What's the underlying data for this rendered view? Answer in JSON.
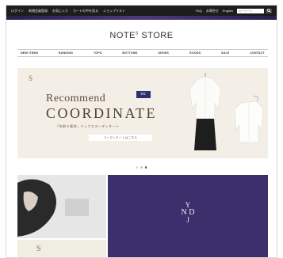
{
  "topbar": {
    "links_left": [
      "ログイン",
      "新規会員登録",
      "お気に入り",
      "カートの中を見る",
      "ショップリスト"
    ],
    "links_right": [
      "FAQ",
      "お問合せ",
      "English"
    ],
    "search_placeholder": "キーワード"
  },
  "strip": {
    "text": ""
  },
  "logo": {
    "main": "NOTE",
    "sup": "S",
    "tail": " STORE"
  },
  "nav": {
    "items": [
      "NEW ITEMS",
      "RANKING",
      "TOPS",
      "BOTTOMS",
      "SHOES",
      "GOODS",
      "SALE",
      "CONTACT"
    ]
  },
  "hero": {
    "brand": "S",
    "brand_small": "",
    "recommend": "Recommend",
    "vol": "Vol.",
    "coordinate": "COORDINATE",
    "subtitle": "「先取り素材」ミックスコーディネート",
    "button": "コーディネートはこちら"
  },
  "carousel": {
    "count": 3,
    "active": 2
  },
  "tiles": {
    "left_bottom_brand": "S",
    "njd": {
      "l1": "Y",
      "l2": "N D",
      "l3": "J"
    },
    "njd_sub": ""
  },
  "colors": {
    "topbar": "#1d1d1d",
    "hero_bg": "#f4efe6",
    "tile_purple": "#3d2f6c",
    "vol_badge": "#2f2f6f"
  }
}
